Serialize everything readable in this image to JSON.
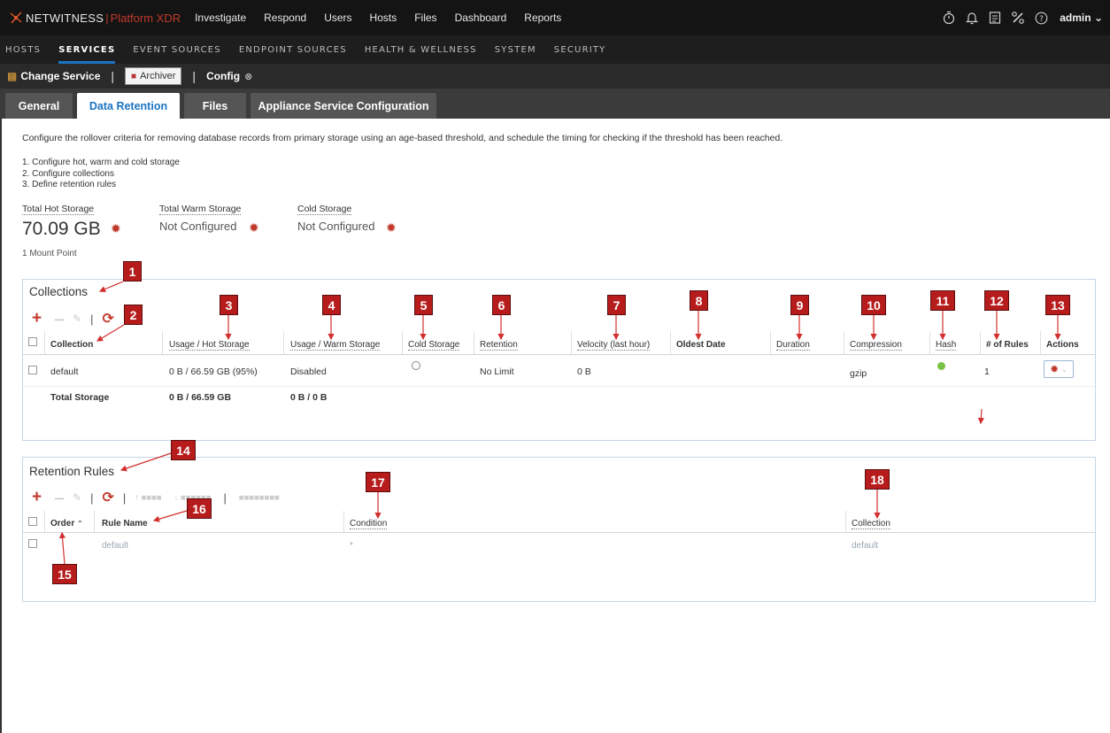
{
  "app": {
    "brand": "NETWITNESS",
    "separator": "|",
    "product": "Platform XDR",
    "user": "admin"
  },
  "topnav": [
    "Investigate",
    "Respond",
    "Users",
    "Hosts",
    "Files",
    "Dashboard",
    "Reports"
  ],
  "adminnav": [
    "HOSTS",
    "SERVICES",
    "EVENT SOURCES",
    "ENDPOINT SOURCES",
    "HEALTH & WELLNESS",
    "SYSTEM",
    "SECURITY"
  ],
  "servicebar": {
    "change_service": "Change Service",
    "service_name": "Archiver",
    "config": "Config"
  },
  "tabs": [
    "General",
    "Data Retention",
    "Files",
    "Appliance Service Configuration"
  ],
  "description": "Configure the rollover criteria for removing database records from primary storage using an age-based threshold, and schedule the timing for checking if the threshold has been reached.",
  "steps": [
    "1. Configure hot, warm and cold storage",
    "2. Configure collections",
    "3. Define retention rules"
  ],
  "storage": {
    "hot_label": "Total Hot Storage",
    "hot_value": "70.09 GB",
    "warm_label": "Total Warm Storage",
    "warm_value": "Not Configured",
    "cold_label": "Cold Storage",
    "cold_value": "Not Configured",
    "mount_points": "1 Mount Point"
  },
  "collections": {
    "title": "Collections",
    "columns": [
      "Collection",
      "Usage / Hot Storage",
      "Usage / Warm Storage",
      "Cold Storage",
      "Retention",
      "Velocity (last hour)",
      "Oldest Date",
      "Duration",
      "Compression",
      "Hash",
      "# of Rules",
      "Actions"
    ],
    "row": {
      "collection": "default",
      "hot": "0 B / 66.59 GB (95%)",
      "warm": "Disabled",
      "retention": "No Limit",
      "velocity": "0 B",
      "compression": "gzip",
      "rules": "1"
    },
    "total": {
      "label": "Total Storage",
      "hot": "0 B / 66.59 GB",
      "warm": "0 B / 0 B"
    }
  },
  "retention_rules": {
    "title": "Retention Rules",
    "columns": [
      "Order",
      "Rule Name",
      "Condition",
      "Collection"
    ],
    "row": {
      "rule_name": "default",
      "condition": "*",
      "collection": "default"
    }
  },
  "badges": [
    "1",
    "2",
    "3",
    "4",
    "5",
    "6",
    "7",
    "8",
    "9",
    "10",
    "11",
    "12",
    "13",
    "14",
    "15",
    "16",
    "17",
    "18"
  ],
  "colors": {
    "accent": "#1a74c4",
    "brand_red": "#c0392b",
    "badge": "#b71c1c",
    "hash_ok": "#7cc242"
  }
}
